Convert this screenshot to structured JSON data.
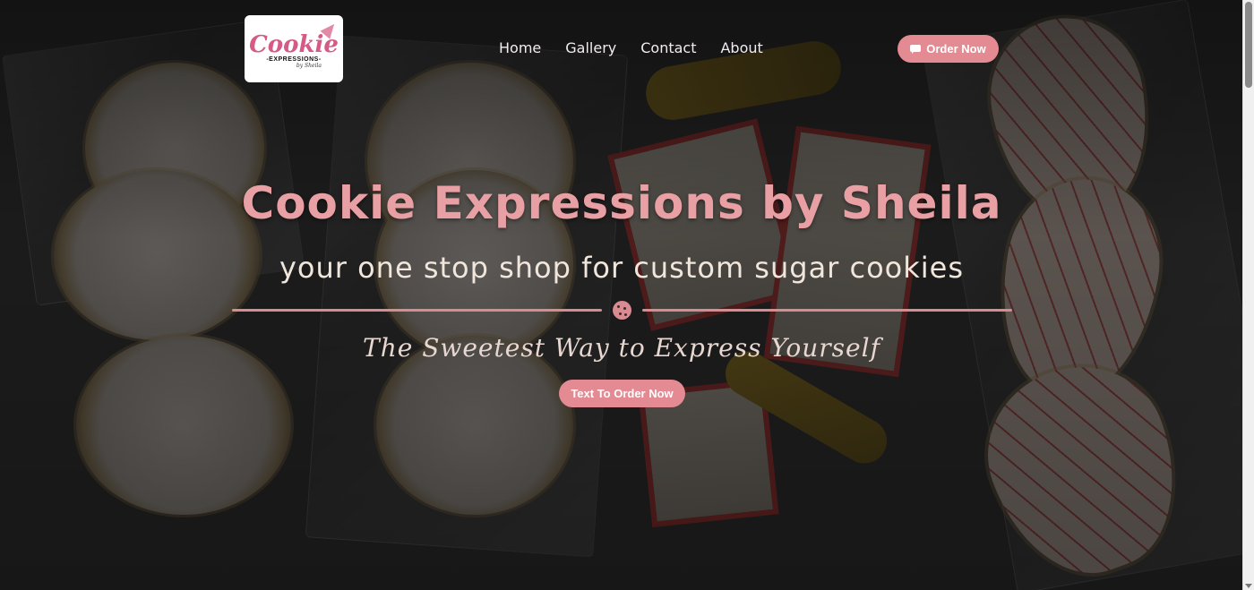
{
  "brand": {
    "logo_script": "Cookie",
    "logo_sub": "-EXPRESSIONS-",
    "logo_sig": "by Sheila"
  },
  "nav": {
    "items": [
      "Home",
      "Gallery",
      "Contact",
      "About"
    ]
  },
  "header": {
    "order_label": "Order Now"
  },
  "hero": {
    "title": "Cookie Expressions by Sheila",
    "subtitle": "your one stop shop for custom sugar cookies",
    "tagline": "The Sweetest Way to Express Yourself",
    "cta_label": "Text To Order Now"
  },
  "colors": {
    "accent": "#e38a92",
    "title": "#e9a0a5"
  },
  "icons": {
    "order": "chat-icon",
    "divider": "cookie-icon"
  }
}
